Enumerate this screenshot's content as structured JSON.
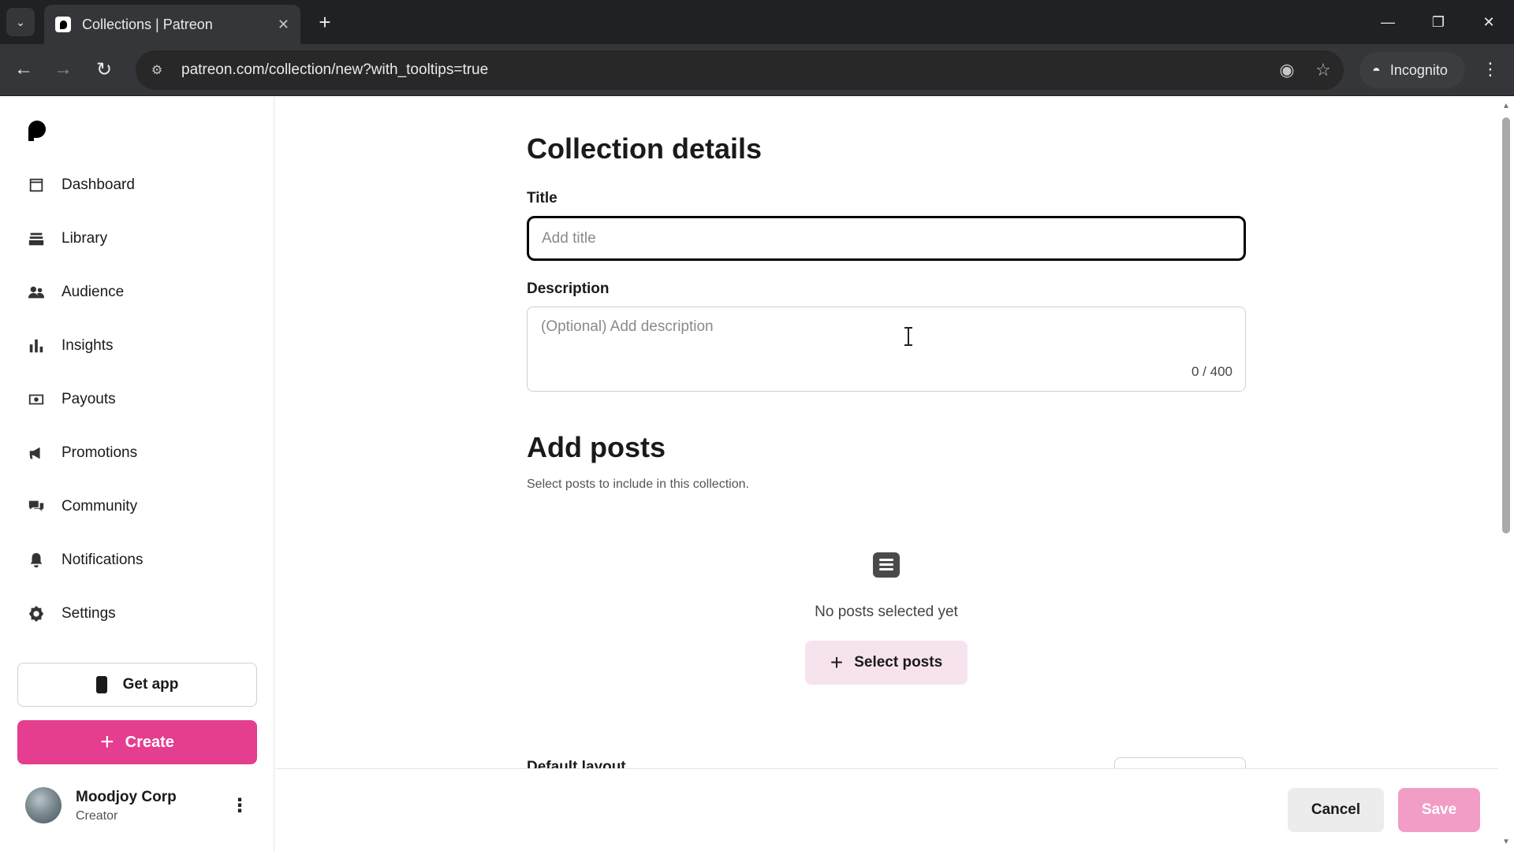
{
  "browser": {
    "tab_title": "Collections | Patreon",
    "url": "patreon.com/collection/new?with_tooltips=true",
    "incognito_label": "Incognito"
  },
  "sidebar": {
    "items": [
      {
        "label": "Dashboard",
        "icon": "dashboard-icon"
      },
      {
        "label": "Library",
        "icon": "library-icon"
      },
      {
        "label": "Audience",
        "icon": "audience-icon"
      },
      {
        "label": "Insights",
        "icon": "insights-icon"
      },
      {
        "label": "Payouts",
        "icon": "payouts-icon"
      },
      {
        "label": "Promotions",
        "icon": "promotions-icon"
      },
      {
        "label": "Community",
        "icon": "community-icon"
      },
      {
        "label": "Notifications",
        "icon": "notifications-icon"
      },
      {
        "label": "Settings",
        "icon": "settings-icon"
      }
    ],
    "get_app_label": "Get app",
    "create_label": "Create",
    "profile": {
      "name": "Moodjoy Corp",
      "role": "Creator"
    }
  },
  "main": {
    "heading": "Collection details",
    "title_label": "Title",
    "title_placeholder": "Add title",
    "title_value": "",
    "description_label": "Description",
    "description_placeholder": "(Optional) Add description",
    "description_counter": "0 / 400",
    "add_posts_heading": "Add posts",
    "add_posts_subtitle": "Select posts to include in this collection.",
    "empty_state_text": "No posts selected yet",
    "select_posts_label": "Select posts",
    "default_layout_label": "Default layout"
  },
  "footer": {
    "cancel_label": "Cancel",
    "save_label": "Save"
  },
  "colors": {
    "create_button": "#e53d8f",
    "save_button_disabled": "#f29dc6",
    "select_posts_bg": "#f7e3ee"
  }
}
